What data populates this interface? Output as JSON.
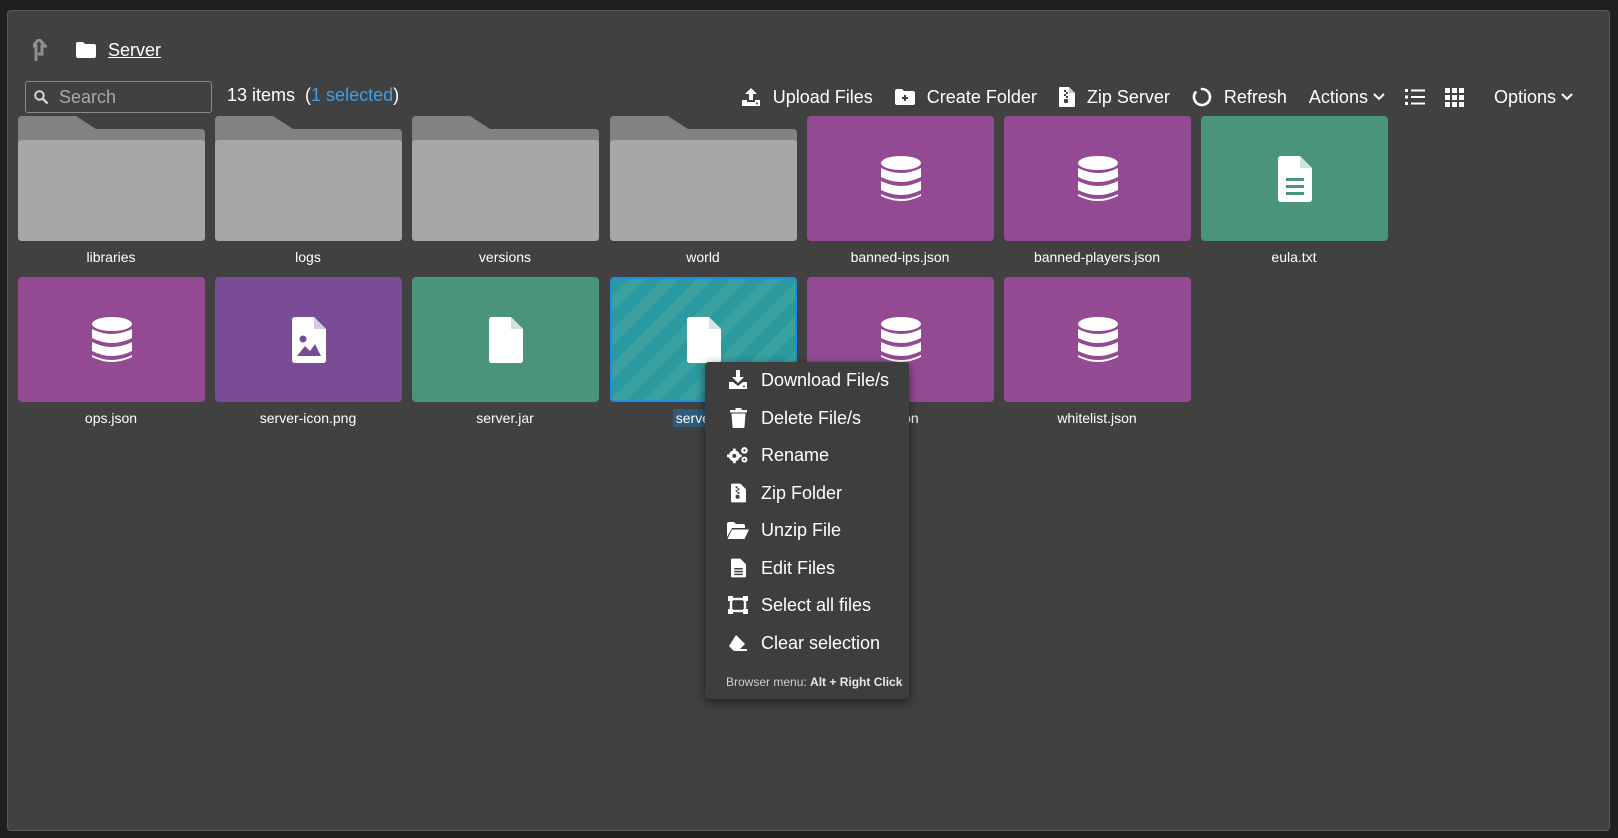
{
  "breadcrumb": {
    "current": "Server"
  },
  "search": {
    "placeholder": "Search"
  },
  "status": {
    "count_text": "13 items",
    "open_paren": "(",
    "selected_text": "1 selected",
    "close_paren": ")"
  },
  "toolbar": {
    "upload": "Upload Files",
    "create_folder": "Create Folder",
    "zip_server": "Zip Server",
    "refresh": "Refresh",
    "actions": "Actions",
    "options": "Options"
  },
  "files": [
    {
      "name": "libraries",
      "type": "folder"
    },
    {
      "name": "logs",
      "type": "folder"
    },
    {
      "name": "versions",
      "type": "folder"
    },
    {
      "name": "world",
      "type": "folder"
    },
    {
      "name": "banned-ips.json",
      "type": "json"
    },
    {
      "name": "banned-players.json",
      "type": "json"
    },
    {
      "name": "eula.txt",
      "type": "text"
    },
    {
      "name": "ops.json",
      "type": "json"
    },
    {
      "name": "server-icon.png",
      "type": "image"
    },
    {
      "name": "server.jar",
      "type": "file"
    },
    {
      "name": "server.pr",
      "type": "file",
      "selected": true
    },
    {
      "name": "e.json",
      "type": "json"
    },
    {
      "name": "whitelist.json",
      "type": "json"
    }
  ],
  "context_menu": {
    "items": [
      "Download File/s",
      "Delete File/s",
      "Rename",
      "Zip Folder",
      "Unzip File",
      "Edit Files",
      "Select all files",
      "Clear selection"
    ],
    "hint_prefix": "Browser menu:",
    "hint_keys": "Alt + Right Click"
  },
  "colors": {
    "folder": "#a7a7a7",
    "json_tile": "#944a93",
    "image_tile": "#7a4c95",
    "text_tile": "#4a9479",
    "selected_border": "#1d8fe1",
    "selected_text": "#3fa0e8"
  },
  "icons": {
    "up": "arrow-up-icon",
    "folder": "folder-icon",
    "search": "search-icon",
    "upload": "upload-icon",
    "create_folder": "folder-plus-icon",
    "zip": "file-zip-icon",
    "refresh": "refresh-icon",
    "chevron": "chevron-down-icon",
    "list_view": "list-view-icon",
    "grid_view": "grid-view-icon",
    "database": "database-icon",
    "document": "document-icon",
    "image": "image-file-icon"
  }
}
